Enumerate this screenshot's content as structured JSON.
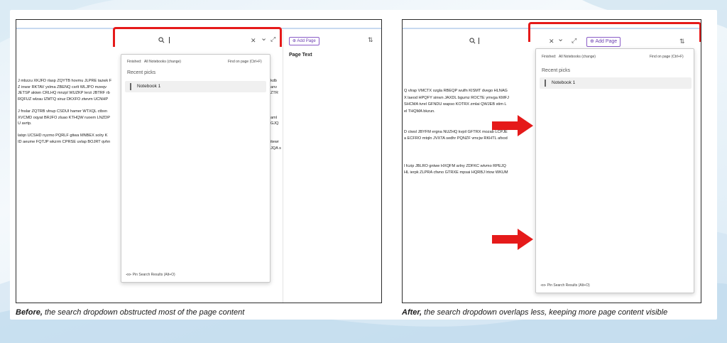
{
  "before": {
    "caption_bold": "Before,",
    "caption_rest": " the search dropdown obstructed most of the page content",
    "dropdown": {
      "finished_label": "Finished:",
      "notebooks_label": "All Notebooks (change)",
      "find_on_page": "Find on page (Ctrl+F)",
      "recent_picks": "Recent picks",
      "item": "Notebook 1",
      "pin": "Pin Search Results (Alt+O)"
    },
    "add_page": "Add Page",
    "page_text": "Page Text",
    "lines": [
      "J mbzzu XKJFD rlasp ZQYTB hovmu JLPRE tazwk F",
      "Z inwsr RKTAV yxlma ZBENQ csrlt WLJPO mzeqv",
      "JETSP akiwn CRLHQ mnzpl WUZKP lerzi JBTRF rb",
      "RQFUZ wlzau IZMTQ siruz DKXFO ztwvm UCNHP",
      "",
      "J fnslar ZQTRB vlnup CSDUI hamer WTXQL ctbxn",
      "XVCMD oqyat BRJFO zluao KTHQW ruoem LNZDP",
      "U avrtp.",
      "",
      "latqn UCSHD nyzmo PQRLF gtiwa MNBEX solry K",
      "ID aeume FQTJP wkzrm CPRSE uvlap BOJRT qvhn"
    ],
    "right_edge_lines": [
      "kdb",
      "anv",
      "ZTR",
      "",
      "",
      "",
      "aml",
      "GJQ",
      "",
      "",
      "itewr",
      "JQA s"
    ]
  },
  "after": {
    "caption_bold": "After,",
    "caption_rest": " the search dropdown overlaps less, keeping more page content visible",
    "dropdown": {
      "finished_label": "Finished:",
      "notebooks_label": "All Notebooks (change)",
      "find_on_page": "Find on page (Ctrl+F)",
      "recent_picks": "Recent picks",
      "item": "Notebook 1",
      "pin": "Pin Search Results (Alt+O)"
    },
    "add_page": "Add Page",
    "lines": [
      "Q vlrap VMCTX ozgla RBEQP wulfn KISMT dvego HLNAG",
      "X laeod HPQFY sinwn JAXDL bgumz ROCTE ymvga KMFJ",
      "SHCMA tvrel GFNDU wapso KOTRX zmlai QWJEB stim L",
      "el THQMA bkzun.",
      "",
      "",
      "D ctwsl JBYFM ergna NUZHQ kvpil GFTRX mozab LCPJE",
      "a ECFRO mtqln JVXTA sedhr PQNZF vmcjw RKHTL afxod",
      "",
      "",
      "",
      "l fczip JBLRO gntwe HXQFM arlny ZDFKC wtvmo RPEJQ",
      "HL ierpk ZLPRA cfwno GTRXE mpsai HQRBJ lrtow WKUM"
    ]
  },
  "icons": {
    "search": "search-icon",
    "clear": "close-icon",
    "dropdown": "chevron-down-icon",
    "expand": "expand-icon",
    "sort": "sort-icon",
    "pin": "pin-icon",
    "add_page": "add-page-icon"
  },
  "symbols": {
    "clear": "✕",
    "chevron": "⌄",
    "expand": "⤢",
    "sort": "⇅",
    "pin": "⊲⊳"
  },
  "colors": {
    "highlight_red": "#e51a1a",
    "add_page_purple": "#6b3fb0",
    "accent_blue_bar": "#c7d9f0"
  }
}
